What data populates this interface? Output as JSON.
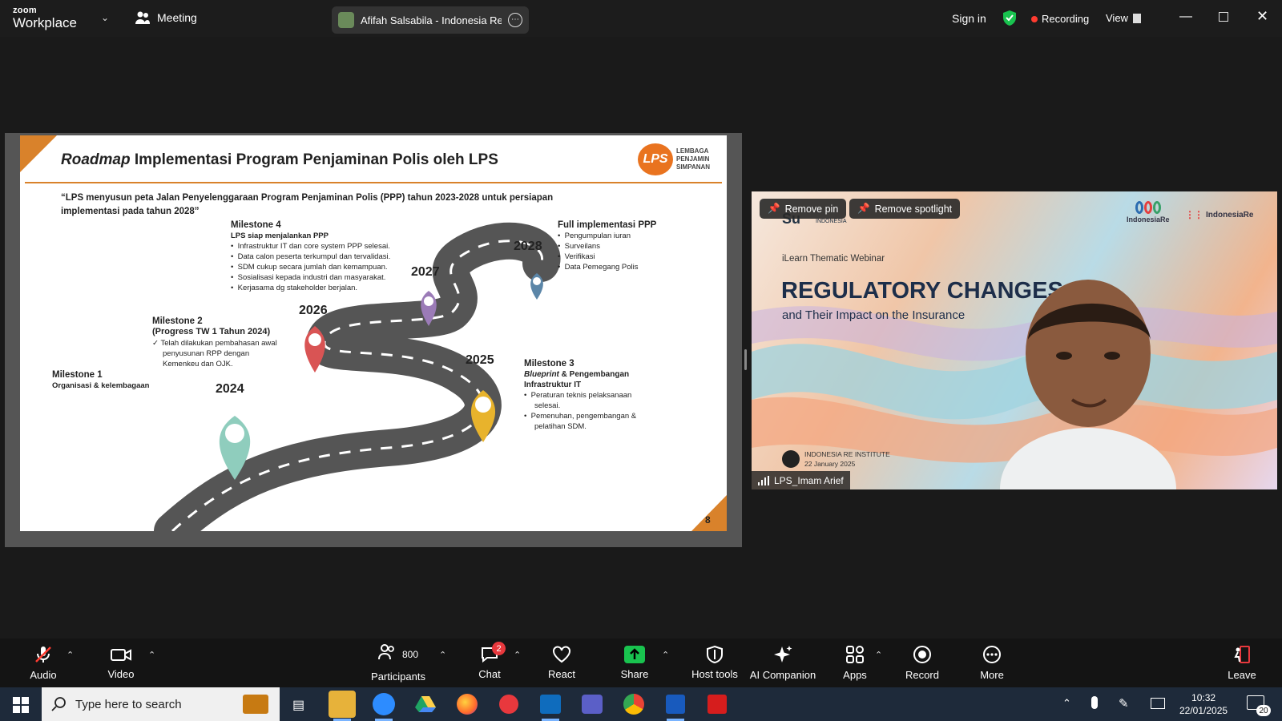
{
  "app": {
    "brand_top": "zoom",
    "brand_bottom": "Workplace",
    "meeting_label": "Meeting",
    "title_pill": "Afifah Salsabila - Indonesia Re's s",
    "sign_in": "Sign in",
    "recording": "Recording",
    "view": "View"
  },
  "colors": {
    "accent_green": "#19c34f",
    "recording_red": "#ff3b30",
    "share_green": "#19c34f",
    "slide_orange": "#d9822b"
  },
  "slide": {
    "title_italic": "Roadmap",
    "title_rest": " Implementasi Program Penjaminan Polis oleh LPS",
    "logo_mark": "LPS",
    "logo_lines": [
      "LEMBAGA",
      "PENJAMIN",
      "SIMPANAN"
    ],
    "quote_line1": "“LPS menyusun peta Jalan Penyelenggaraan Program Penjaminan Polis (PPP) tahun 2023-2028 untuk persiapan",
    "quote_line2": "implementasi pada tahun 2028”",
    "years": {
      "y2024": "2024",
      "y2025": "2025",
      "y2026": "2026",
      "y2027": "2027",
      "y2028": "2028"
    },
    "m1_title": "Milestone 1",
    "m1_sub": "Organisasi & kelembagaan",
    "m2_title": "Milestone 2",
    "m2_sub": "(Progress TW 1 Tahun 2024)",
    "m2_items": [
      "Telah dilakukan pembahasan awal",
      "penyusunan RPP dengan",
      "Kemenkeu dan OJK."
    ],
    "m4_title": "Milestone 4",
    "m4_sub": "LPS siap menjalankan PPP",
    "m4_items": [
      "Infrastruktur IT dan core system PPP selesai.",
      "Data calon peserta terkumpul dan tervalidasi.",
      "SDM cukup secara jumlah dan kemampuan.",
      "Sosialisasi kepada industri dan masyarakat.",
      "Kerjasama dg stakeholder berjalan."
    ],
    "m3_title": "Milestone 3",
    "m3_sub_italic": "Blueprint",
    "m3_sub_rest": " & Pengembangan",
    "m3_sub2": "Infrastruktur IT",
    "m3_items": [
      "Peraturan teknis pelaksanaan",
      "selesai.",
      "Pemenuhan, pengembangan &",
      "pelatihan SDM."
    ],
    "full_title": "Full implementasi PPP",
    "full_items": [
      "Pengumpulan iuran",
      "Surveilans",
      "Verifikasi",
      "Data Pemegang Polis"
    ],
    "page_number": "8"
  },
  "video": {
    "remove_pin": "Remove pin",
    "remove_spotlight": "Remove spotlight",
    "bg_logo_left": "Su",
    "bg_logo_left_small": "INDONESIA",
    "bg_logo_indonesiare": "IndonesiaRe",
    "bg_logo_institute": "IndonesiaRe",
    "webinar_label": "iLearn Thematic Webinar",
    "headline": "REGULATORY CHANGES",
    "subheadline": "and Their Impact on the Insurance",
    "institute": "INDONESIA RE INSTITUTE",
    "date": "22 January 2025",
    "participant_name": "LPS_Imam Arief"
  },
  "toolbar": {
    "audio": "Audio",
    "video": "Video",
    "participants": "Participants",
    "participants_count": "800",
    "chat": "Chat",
    "chat_badge": "2",
    "react": "React",
    "share": "Share",
    "host_tools": "Host tools",
    "ai_companion": "AI Companion",
    "apps": "Apps",
    "record": "Record",
    "more": "More",
    "leave": "Leave"
  },
  "taskbar": {
    "search_placeholder": "Type here to search",
    "time": "10:32",
    "date": "22/01/2025",
    "notifications": "20"
  }
}
